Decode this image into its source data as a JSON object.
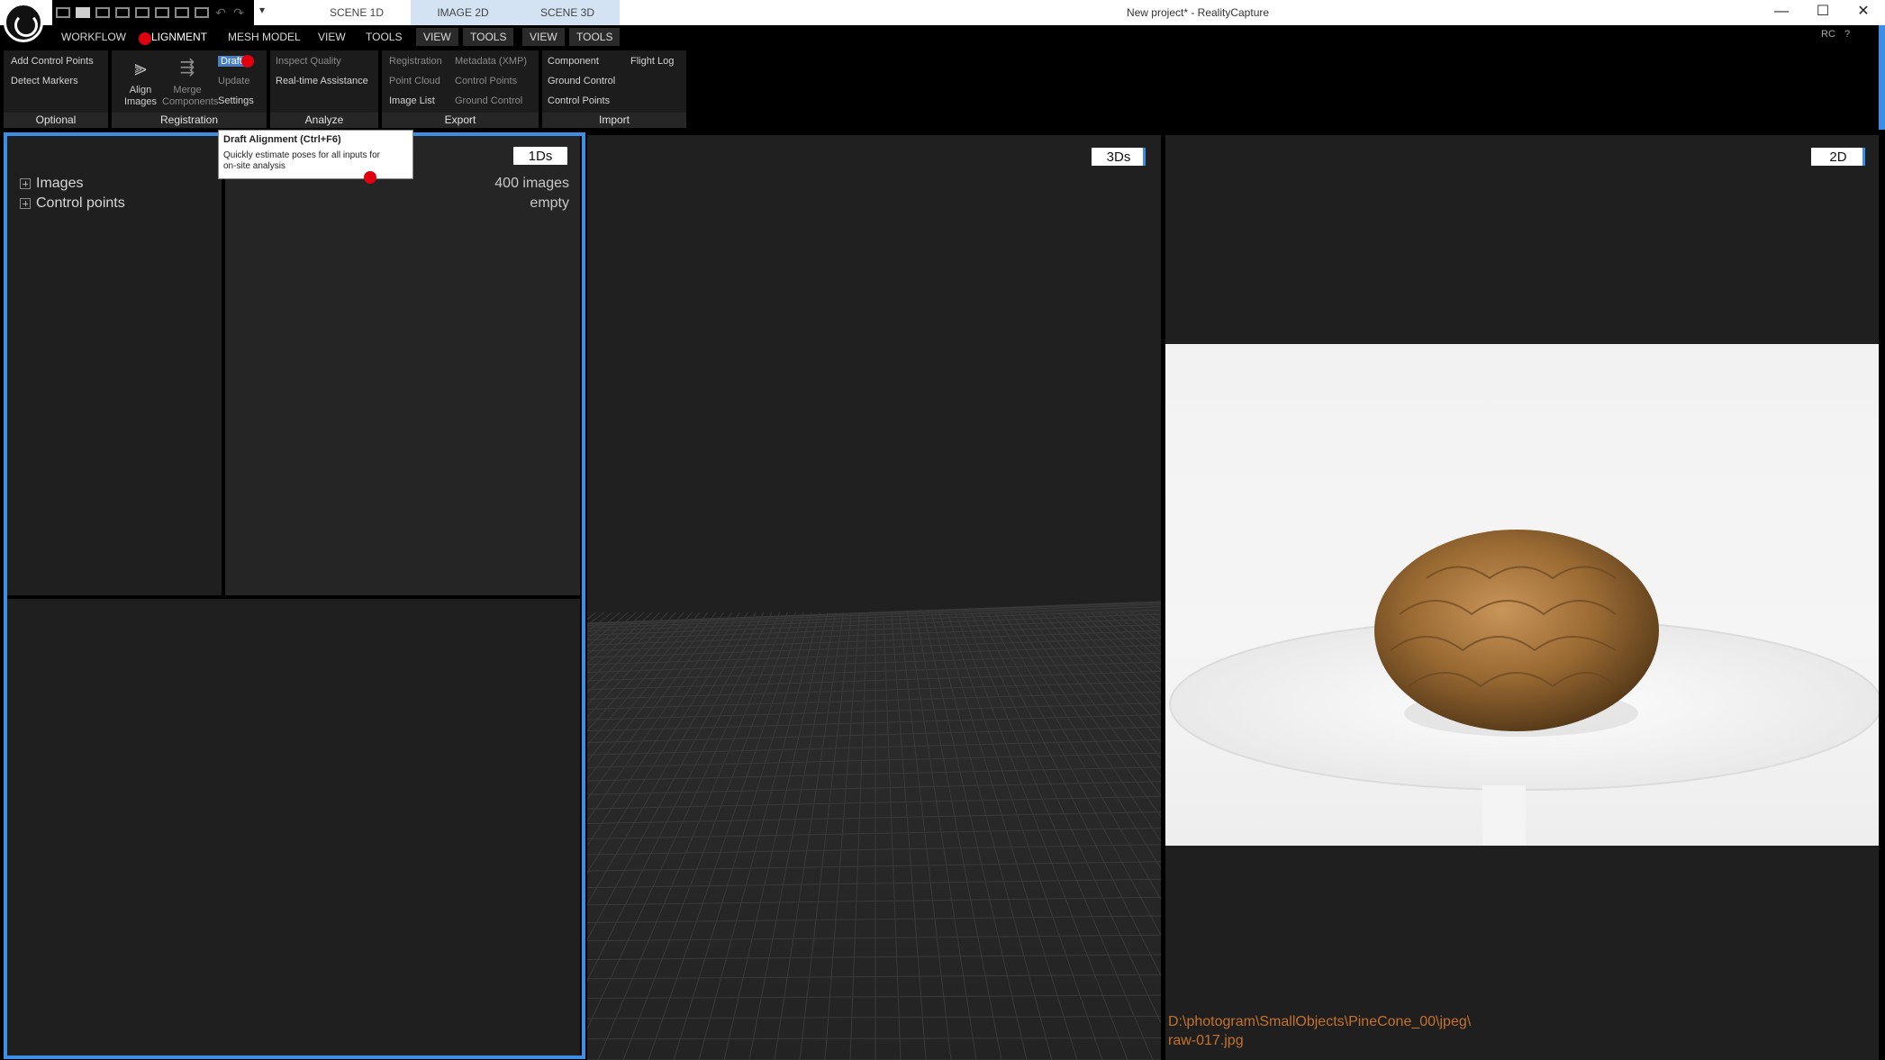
{
  "window": {
    "title": "New project* - RealityCapture",
    "controls": {
      "minimize": "—",
      "maximize": "☐",
      "close": "✕"
    }
  },
  "quick_access": {
    "more": "▾",
    "undo": "↶",
    "redo": "↷"
  },
  "top_tabs": [
    "SCENE 1D",
    "IMAGE 2D",
    "SCENE 3D"
  ],
  "menus": [
    "WORKFLOW",
    "ALIGNMENT",
    "MESH MODEL",
    "VIEW",
    "TOOLS",
    "VIEW",
    "TOOLS",
    "VIEW",
    "TOOLS"
  ],
  "menu_alignment_visible": "LIGNMENT",
  "corner": {
    "rc": "RC",
    "help": "?"
  },
  "ribbon": {
    "optional": {
      "title": "Optional",
      "items": [
        "Add Control Points",
        "Detect Markers"
      ]
    },
    "registration": {
      "title": "Registration",
      "align_label_1": "Align",
      "align_label_2": "Images",
      "merge_label_1": "Merge",
      "merge_label_2": "Components",
      "draft": "Draft",
      "update": "Update",
      "settings": "Settings"
    },
    "analyze": {
      "title": "Analyze",
      "items": [
        "Inspect Quality",
        "Real-time Assistance"
      ]
    },
    "export": {
      "title": "Export",
      "col1": [
        "Registration",
        "Point Cloud",
        "Image List"
      ],
      "col2": [
        "Metadata (XMP)",
        "Control Points",
        "Ground Control"
      ]
    },
    "import": {
      "title": "Import",
      "col1": [
        "Component",
        "Ground Control",
        "Control Points"
      ],
      "col2": [
        "Flight Log"
      ]
    }
  },
  "tooltip": {
    "title": "Draft Alignment (Ctrl+F6)",
    "line1": "Quickly estimate poses for all inputs for",
    "line2": "on-site analysis"
  },
  "panel_1ds": {
    "badge": "1Ds",
    "tree": [
      "Images",
      "Control points"
    ],
    "info": [
      "400 images",
      "empty"
    ]
  },
  "panel_3ds": {
    "badge": "3Ds"
  },
  "panel_2d": {
    "badge": "2D",
    "path_line1": "D:\\photogram\\SmallObjects\\PineCone_00\\jpeg\\",
    "path_line2": "raw-017.jpg"
  },
  "colors": {
    "accent": "#3d8fe6",
    "highlight": "#e0000f",
    "path": "#c4722c"
  }
}
